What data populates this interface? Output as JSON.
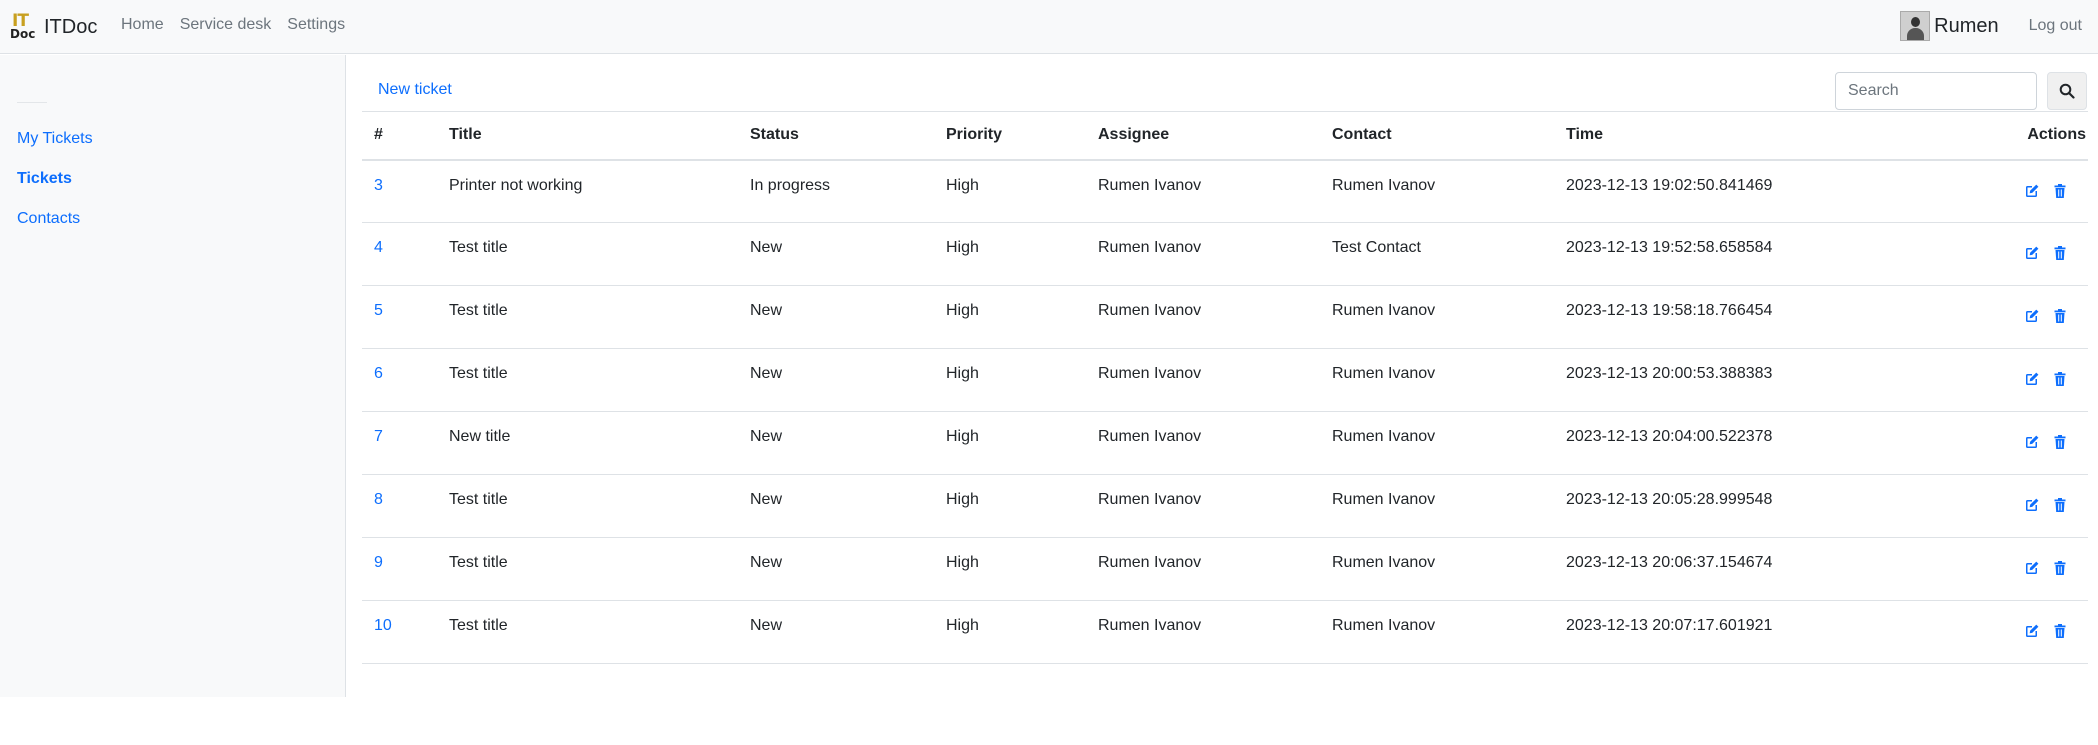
{
  "navbar": {
    "brand_name": "ITDoc",
    "logo_text_top": "IT",
    "logo_text_bottom": "Doc",
    "links": [
      "Home",
      "Service desk",
      "Settings"
    ],
    "username": "Rumen",
    "logout_label": "Log out"
  },
  "sidebar": {
    "items": [
      {
        "label": "My Tickets"
      },
      {
        "label": "Tickets"
      },
      {
        "label": "Contacts"
      }
    ]
  },
  "main": {
    "new_ticket_label": "New ticket",
    "search_placeholder": "Search",
    "columns": [
      "#",
      "Title",
      "Status",
      "Priority",
      "Assignee",
      "Contact",
      "Time",
      "Actions"
    ],
    "rows": [
      {
        "id": "3",
        "title": "Printer not working",
        "status": "In progress",
        "priority": "High",
        "assignee": "Rumen Ivanov",
        "contact": "Rumen Ivanov",
        "time": "2023-12-13 19:02:50.841469"
      },
      {
        "id": "4",
        "title": "Test title",
        "status": "New",
        "priority": "High",
        "assignee": "Rumen Ivanov",
        "contact": "Test Contact",
        "time": "2023-12-13 19:52:58.658584"
      },
      {
        "id": "5",
        "title": "Test title",
        "status": "New",
        "priority": "High",
        "assignee": "Rumen Ivanov",
        "contact": "Rumen Ivanov",
        "time": "2023-12-13 19:58:18.766454"
      },
      {
        "id": "6",
        "title": "Test title",
        "status": "New",
        "priority": "High",
        "assignee": "Rumen Ivanov",
        "contact": "Rumen Ivanov",
        "time": "2023-12-13 20:00:53.388383"
      },
      {
        "id": "7",
        "title": "New title",
        "status": "New",
        "priority": "High",
        "assignee": "Rumen Ivanov",
        "contact": "Rumen Ivanov",
        "time": "2023-12-13 20:04:00.522378"
      },
      {
        "id": "8",
        "title": "Test title",
        "status": "New",
        "priority": "High",
        "assignee": "Rumen Ivanov",
        "contact": "Rumen Ivanov",
        "time": "2023-12-13 20:05:28.999548"
      },
      {
        "id": "9",
        "title": "Test title",
        "status": "New",
        "priority": "High",
        "assignee": "Rumen Ivanov",
        "contact": "Rumen Ivanov",
        "time": "2023-12-13 20:06:37.154674"
      },
      {
        "id": "10",
        "title": "Test title",
        "status": "New",
        "priority": "High",
        "assignee": "Rumen Ivanov",
        "contact": "Rumen Ivanov",
        "time": "2023-12-13 20:07:17.601921"
      }
    ],
    "action_icons": [
      "edit-icon",
      "trash-icon"
    ]
  },
  "colors": {
    "link": "#0d6efd",
    "nav_bg": "#f8f9fa",
    "border": "#dee2e6",
    "muted": "#6c757d"
  }
}
